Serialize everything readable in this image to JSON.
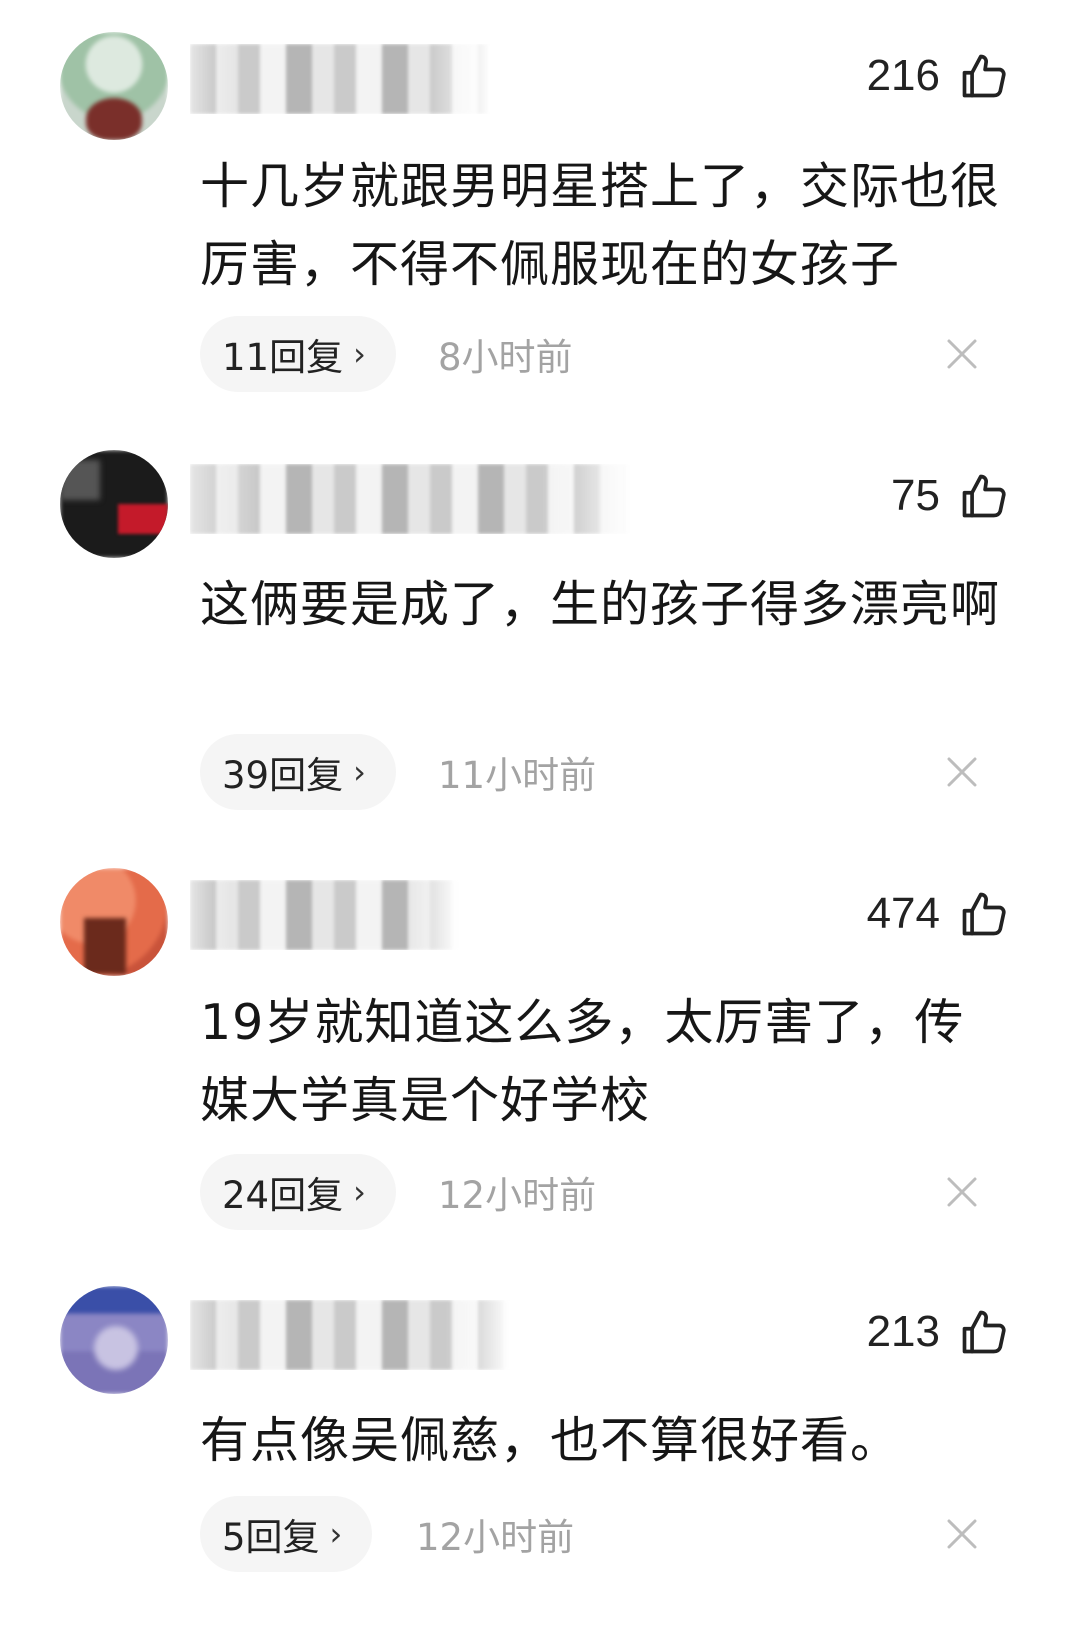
{
  "comments": [
    {
      "likes": "216",
      "text": "十几岁就跟男明星搭上了，交际也很厉害，不得不佩服现在的女孩子",
      "reply_count": "11回复",
      "time": "8小时前",
      "avatar_color": "#9fc2a6",
      "avatar_accent": "#7a2f2a"
    },
    {
      "likes": "75",
      "text": "这俩要是成了，生的孩子得多漂亮啊",
      "reply_count": "39回复",
      "time": "11小时前",
      "avatar_color": "#1b1b1b",
      "avatar_accent": "#c41a2a"
    },
    {
      "likes": "474",
      "text": "19岁就知道这么多，太厉害了，传媒大学真是个好学校",
      "reply_count": "24回复",
      "time": "12小时前",
      "avatar_color": "#e46b4a",
      "avatar_accent": "#6b2a1c"
    },
    {
      "likes": "213",
      "text": "有点像吴佩慈，也不算很好看。",
      "reply_count": "5回复",
      "time": "12小时前",
      "avatar_color": "#7b74b7",
      "avatar_accent": "#3a4fa8"
    }
  ],
  "icons": {
    "like": "thumbs-up-icon",
    "chevron": "chevron-right-icon",
    "dismiss": "close-icon"
  }
}
